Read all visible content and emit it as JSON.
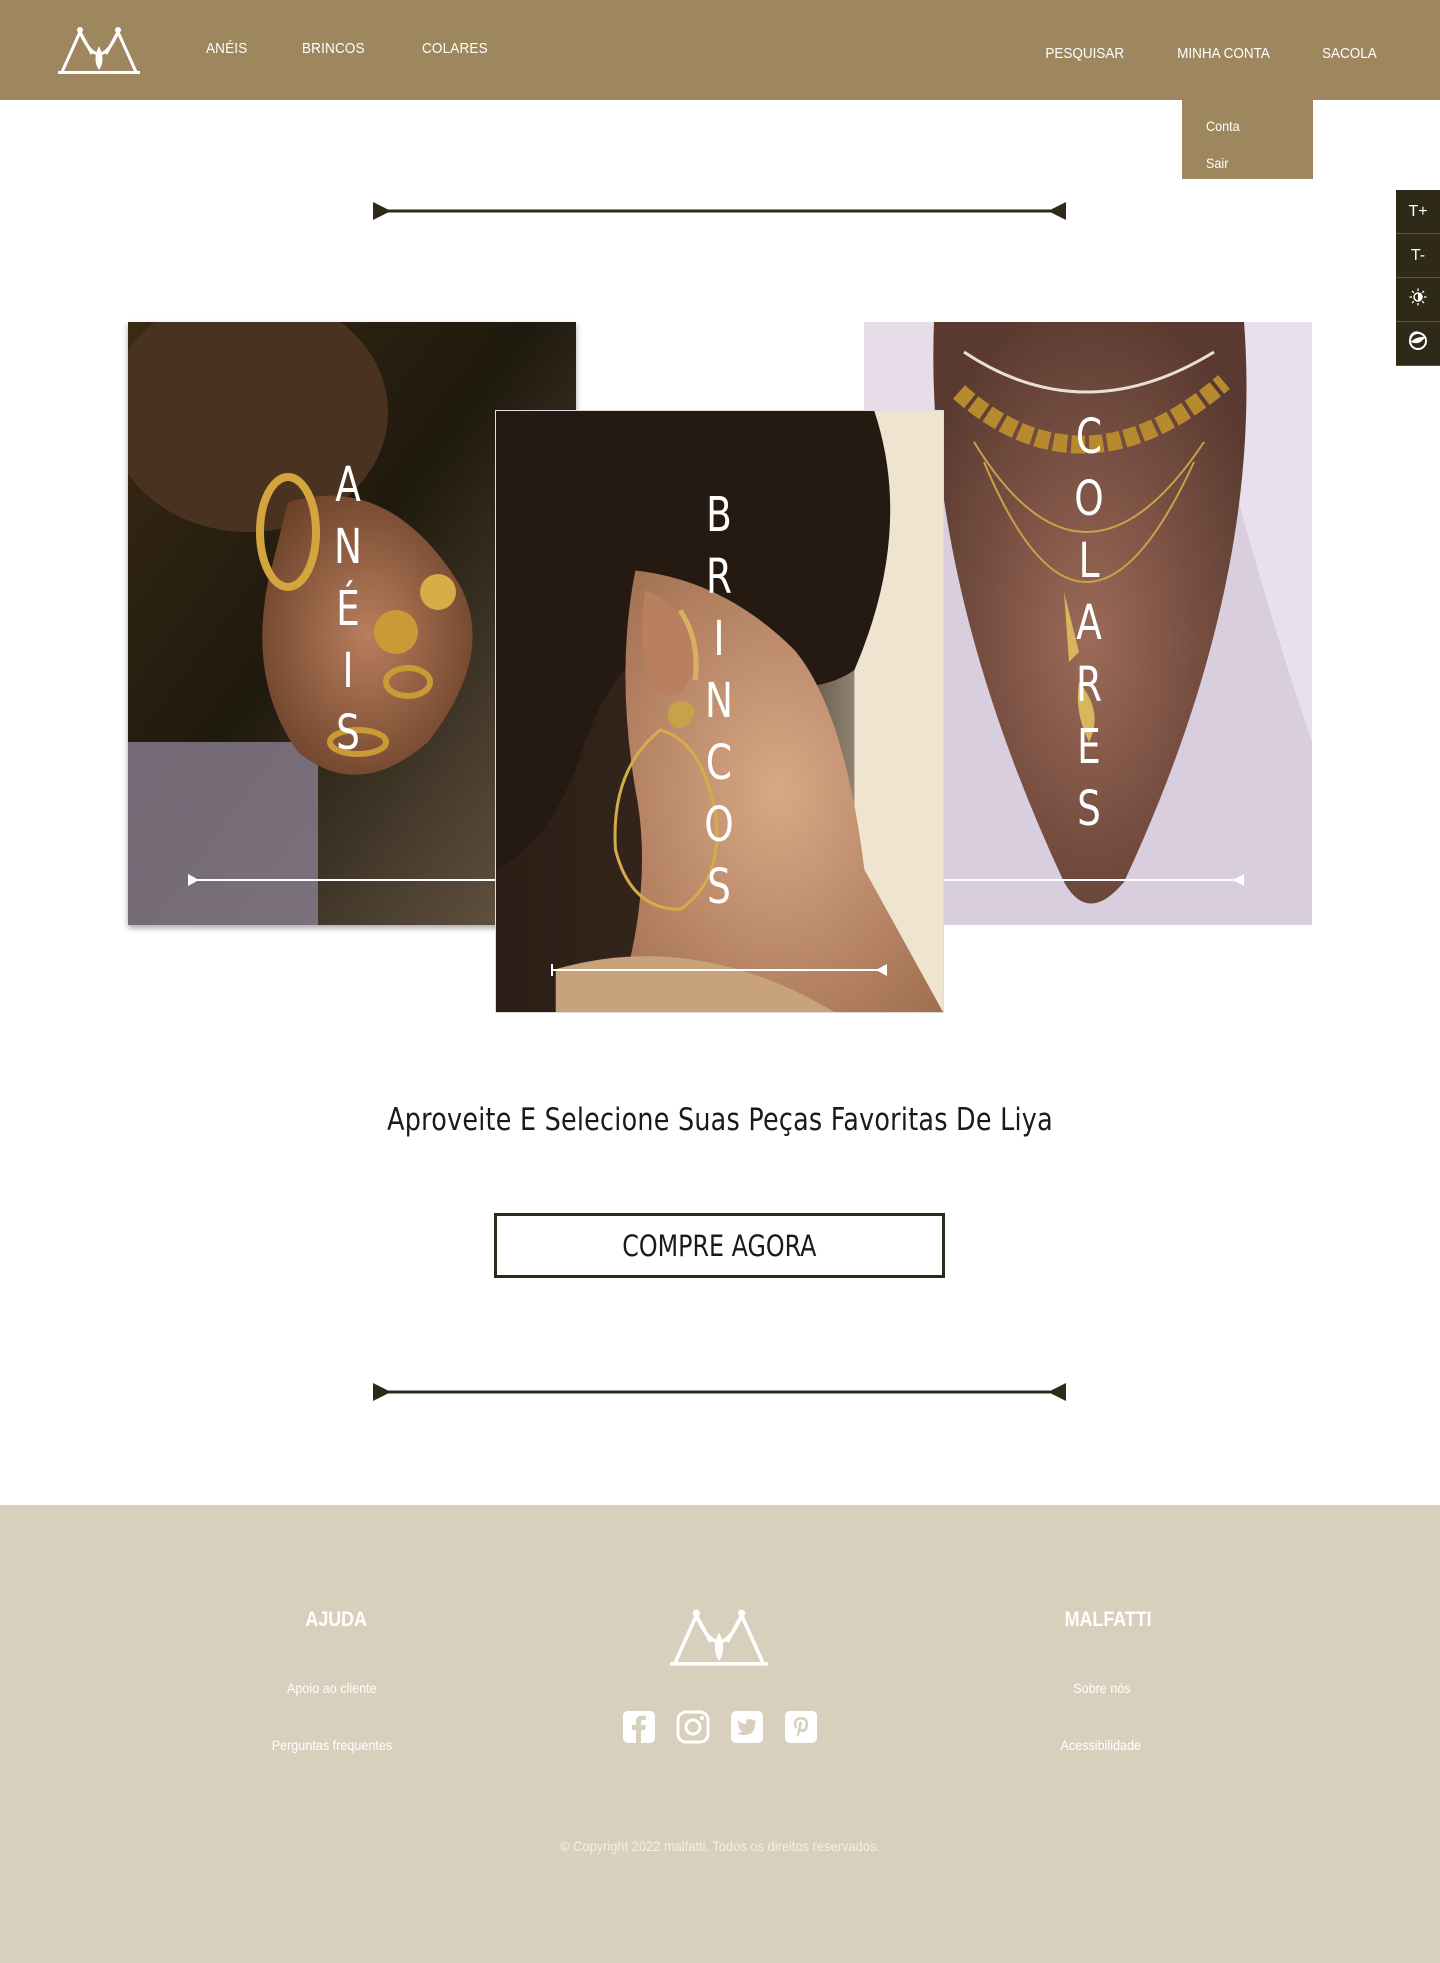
{
  "header": {
    "nav_left": [
      "ANÉIS",
      "BRINCOS",
      "COLARES"
    ],
    "nav_right": [
      "PESQUISAR",
      "MINHA CONTA",
      "SACOLA"
    ],
    "account_menu": [
      "Conta",
      "Sair"
    ]
  },
  "accessibility": {
    "increase_font": "T+",
    "decrease_font": "T-",
    "brightness_icon": "sun-icon",
    "contrast_icon": "contrast-icon"
  },
  "categories": [
    {
      "label": "ANÉIS",
      "letters": [
        "A",
        "N",
        "É",
        "I",
        "S"
      ]
    },
    {
      "label": "BRINCOS",
      "letters": [
        "B",
        "R",
        "I",
        "N",
        "C",
        "O",
        "S"
      ]
    },
    {
      "label": "COLARES",
      "letters": [
        "C",
        "O",
        "L",
        "A",
        "R",
        "E",
        "S"
      ]
    }
  ],
  "main": {
    "tagline": "Aproveite E Selecione Suas Peças Favoritas De Liya",
    "cta_label": "COMPRE AGORA"
  },
  "footer": {
    "ajuda_title": "AJUDA",
    "ajuda_links": [
      "Apoio ao cliente",
      "Perguntas frequentes"
    ],
    "malfatti_title": "MALFATTI",
    "malfatti_links": [
      "Sobre nós",
      "Acessibilidade"
    ],
    "social_icons": [
      "facebook-icon",
      "instagram-icon",
      "twitter-icon",
      "pinterest-icon"
    ],
    "copyright": "© Copyright 2022 malfatti. Todos os direitos reservados."
  },
  "colors": {
    "header_bg": "#9e875e",
    "footer_bg": "#d8d0bd",
    "dark_accent": "#2e2a17"
  }
}
